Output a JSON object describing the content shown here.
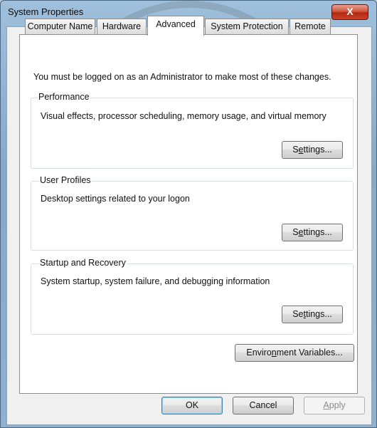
{
  "window": {
    "title": "System Properties",
    "close_glyph": "X"
  },
  "tabs": [
    {
      "label": "Computer Name"
    },
    {
      "label": "Hardware"
    },
    {
      "label": "Advanced",
      "active": true
    },
    {
      "label": "System Protection"
    },
    {
      "label": "Remote"
    }
  ],
  "notice": "You must be logged on as an Administrator to make most of these changes.",
  "groups": {
    "performance": {
      "title": "Performance",
      "description": "Visual effects, processor scheduling, memory usage, and virtual memory",
      "button": "Settings..."
    },
    "user_profiles": {
      "title": "User Profiles",
      "description": "Desktop settings related to your logon",
      "button": "Settings..."
    },
    "startup_recovery": {
      "title": "Startup and Recovery",
      "description": "System startup, system failure, and debugging information",
      "button": "Settings..."
    }
  },
  "env_button": "Environment Variables...",
  "footer": {
    "ok": "OK",
    "cancel": "Cancel",
    "apply": "Apply"
  },
  "colors": {
    "close_button": "#c9442b",
    "default_button_border": "#3c7fb1"
  }
}
